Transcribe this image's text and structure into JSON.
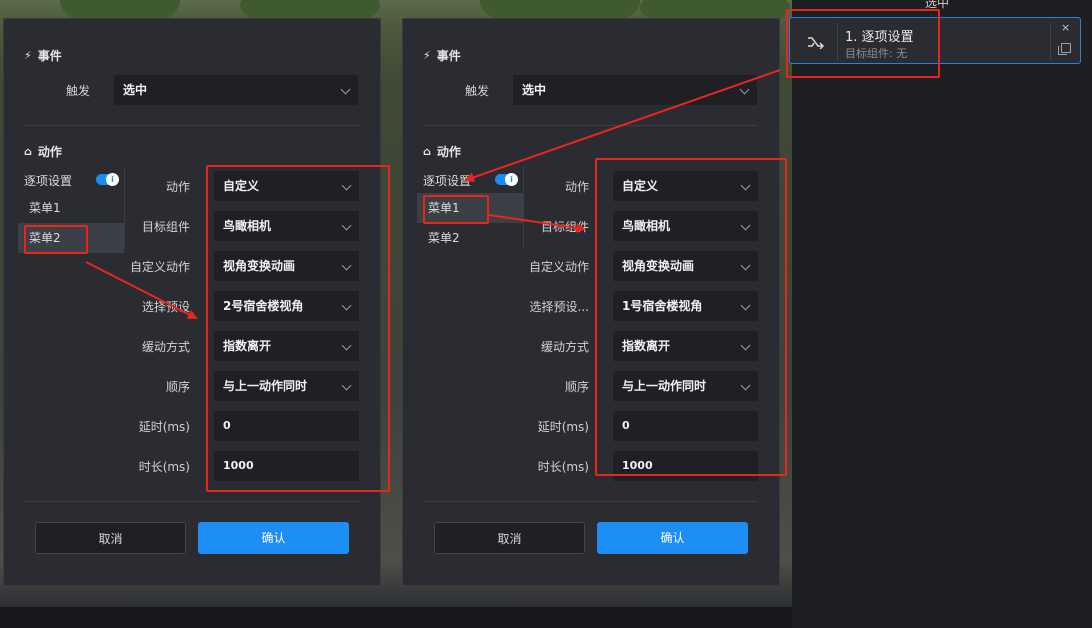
{
  "top_label": "选中",
  "dialogs": [
    {
      "event_title": "事件",
      "trigger_label": "触发",
      "trigger_value": "选中",
      "action_title": "动作",
      "side_header": "逐项设置",
      "toggle_glyph": "i",
      "menu_items": [
        "菜单1",
        "菜单2"
      ],
      "active_menu": "菜单2",
      "fields": [
        {
          "label": "动作",
          "value": "自定义"
        },
        {
          "label": "目标组件",
          "value": "鸟瞰相机"
        },
        {
          "label": "自定义动作",
          "value": "视角变换动画"
        },
        {
          "label": "选择预设",
          "value": "2号宿舍楼视角"
        },
        {
          "label": "缓动方式",
          "value": "指数离开"
        },
        {
          "label": "顺序",
          "value": "与上一动作同时"
        },
        {
          "label": "延时(ms)",
          "value": "0"
        },
        {
          "label": "时长(ms)",
          "value": "1000"
        }
      ],
      "cancel": "取消",
      "confirm": "确认"
    },
    {
      "event_title": "事件",
      "trigger_label": "触发",
      "trigger_value": "选中",
      "action_title": "动作",
      "side_header": "逐项设置",
      "toggle_glyph": "i",
      "menu_items": [
        "菜单1",
        "菜单2"
      ],
      "active_menu": "菜单1",
      "fields": [
        {
          "label": "动作",
          "value": "自定义"
        },
        {
          "label": "目标组件",
          "value": "鸟瞰相机"
        },
        {
          "label": "自定义动作",
          "value": "视角变换动画"
        },
        {
          "label": "选择预设...",
          "value": "1号宿舍楼视角"
        },
        {
          "label": "缓动方式",
          "value": "指数离开"
        },
        {
          "label": "顺序",
          "value": "与上一动作同时"
        },
        {
          "label": "延时(ms)",
          "value": "0"
        },
        {
          "label": "时长(ms)",
          "value": "1000"
        }
      ],
      "cancel": "取消",
      "confirm": "确认"
    }
  ],
  "step_card": {
    "title": "1. 逐项设置",
    "subtitle": "目标组件: 无",
    "icon": "shuffle-icon",
    "close_glyph": "×"
  },
  "colors": {
    "accent": "#1c8ef5",
    "annotation_red": "#e8261f",
    "panel_bg": "#2b2c31",
    "field_bg": "#1f2024"
  }
}
